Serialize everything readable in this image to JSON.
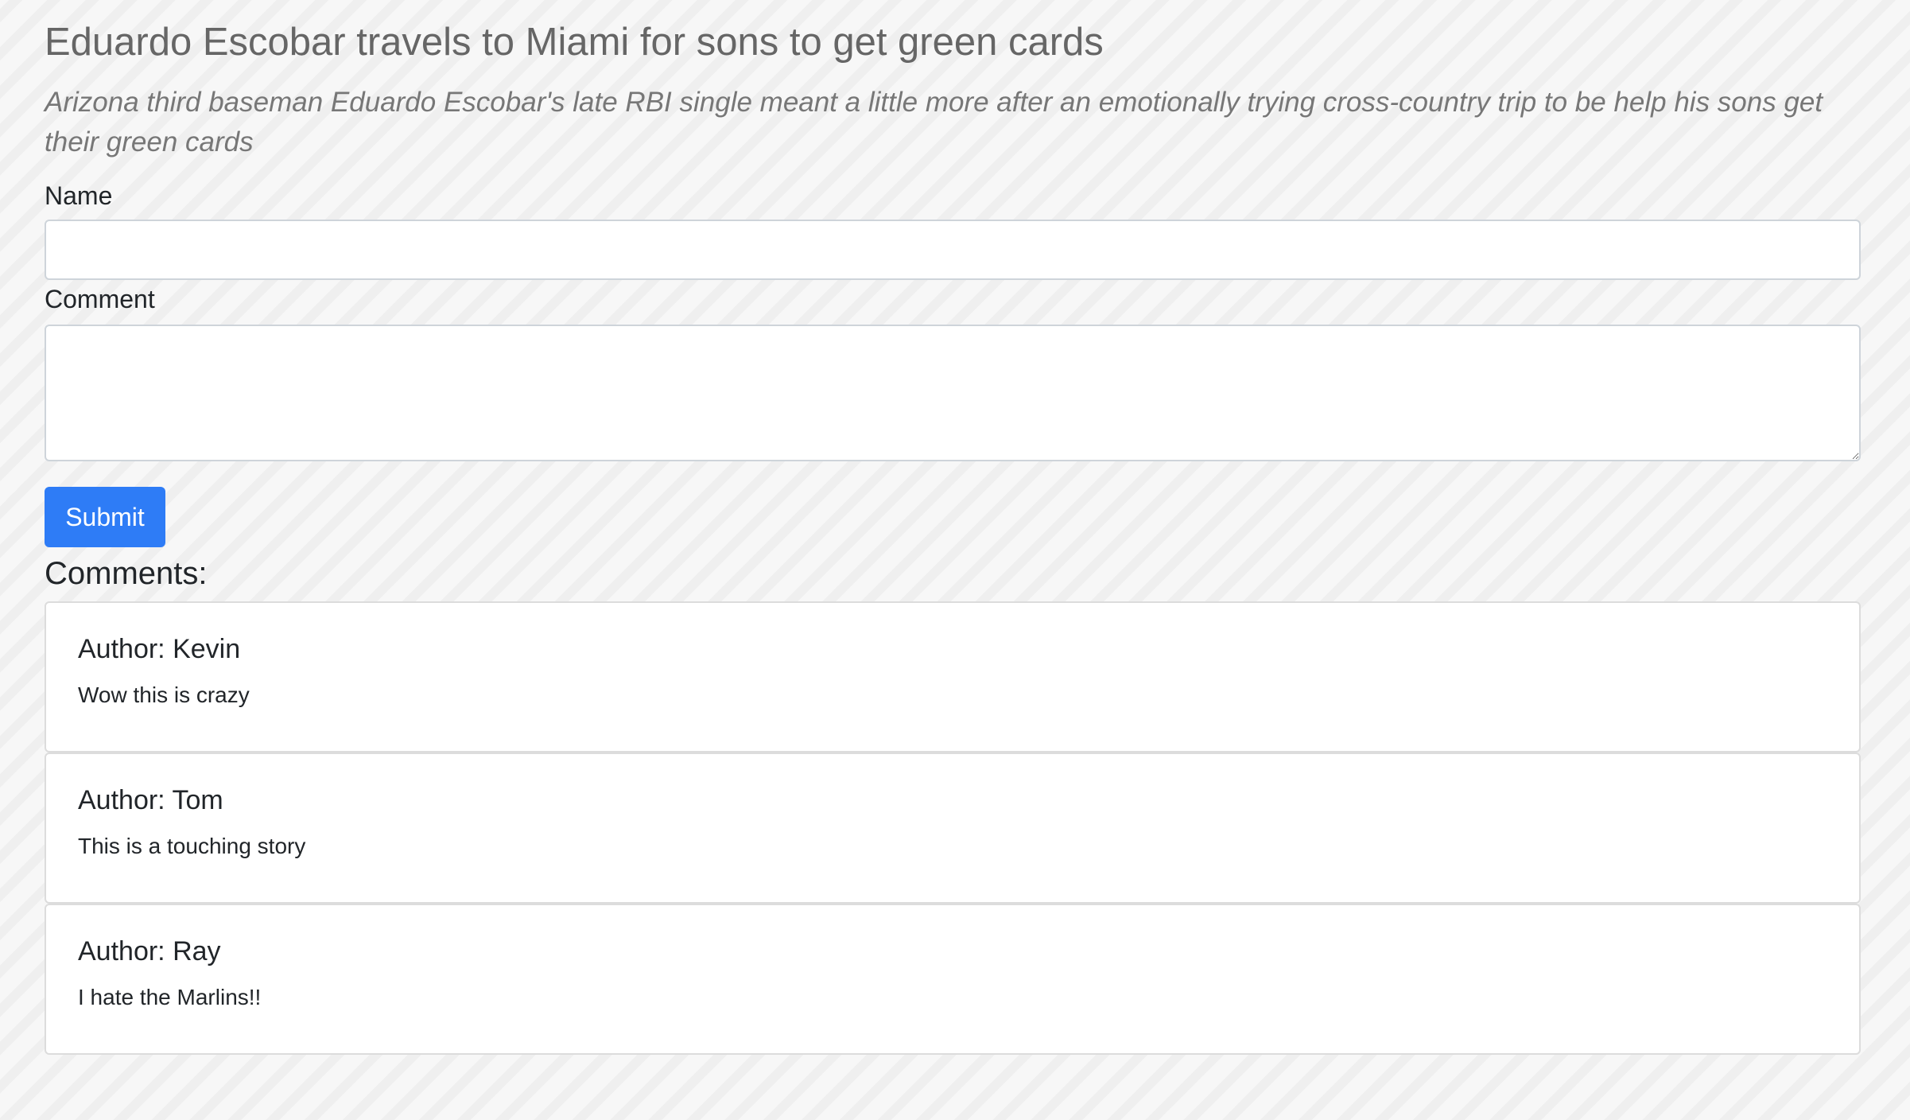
{
  "article": {
    "title": "Eduardo Escobar travels to Miami for sons to get green cards",
    "subtitle": "Arizona third baseman Eduardo Escobar's late RBI single meant a little more after an emotionally trying cross-country trip to be help his sons get their green cards"
  },
  "form": {
    "name_label": "Name",
    "name_value": "",
    "comment_label": "Comment",
    "comment_value": "",
    "submit_label": "Submit",
    "submit_color": "#2e7cf6"
  },
  "comments": {
    "heading": "Comments:",
    "items": [
      {
        "author": "Author: Kevin",
        "text": "Wow this is crazy"
      },
      {
        "author": "Author: Tom",
        "text": "This is a touching story"
      },
      {
        "author": "Author: Ray",
        "text": "I hate the Marlins!!"
      }
    ]
  }
}
